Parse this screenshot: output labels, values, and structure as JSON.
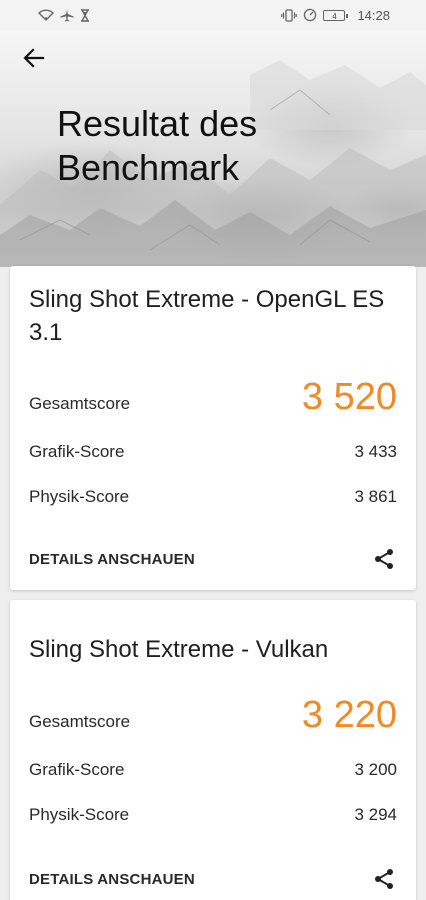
{
  "status_bar": {
    "icons": [
      "wifi-icon",
      "airplane-icon",
      "hourglass-icon",
      "vibrate-icon",
      "data-saver-icon"
    ],
    "battery_level": "4",
    "time": "14:28"
  },
  "header": {
    "back_icon": "arrow-left-icon",
    "title": "Resultat des\nBenchmark"
  },
  "results": [
    {
      "title": "Sling Shot Extreme - OpenGL ES 3.1",
      "total_label": "Gesamtscore",
      "total_value": "3 520",
      "graphics_label": "Grafik-Score",
      "graphics_value": "3 433",
      "physics_label": "Physik-Score",
      "physics_value": "3 861",
      "details_label": "DETAILS ANSCHAUEN",
      "share_icon": "share-icon"
    },
    {
      "title": "Sling Shot Extreme - Vulkan",
      "total_label": "Gesamtscore",
      "total_value": "3 220",
      "graphics_label": "Grafik-Score",
      "graphics_value": "3 200",
      "physics_label": "Physik-Score",
      "physics_value": "3 294",
      "details_label": "DETAILS ANSCHAUEN",
      "share_icon": "share-icon"
    }
  ],
  "colors": {
    "accent": "#f08a24",
    "background": "#efefef",
    "card": "#ffffff"
  }
}
